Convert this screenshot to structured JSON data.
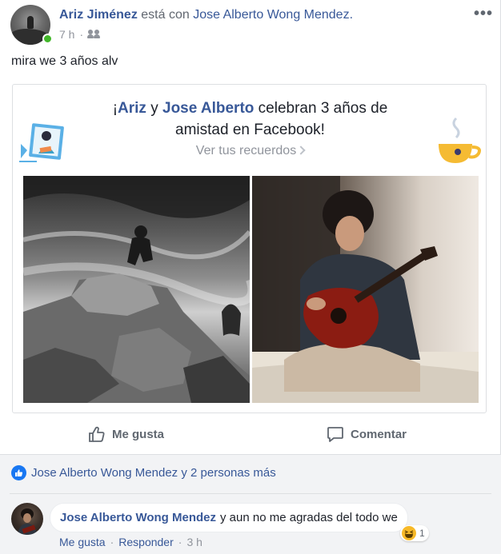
{
  "header": {
    "author": "Ariz Jiménez",
    "connector": "está con",
    "tagged": "Jose Alberto Wong Mendez.",
    "time": "7 h",
    "privacy_icon": "friends-icon",
    "more_icon": "ellipsis-icon"
  },
  "post": {
    "text": "mira we 3 años alv"
  },
  "memory": {
    "prefix": "¡",
    "name1": "Ariz",
    "and": " y ",
    "name2": "Jose Alberto",
    "line1_rest": " celebran 3 años de",
    "line2": "amistad en Facebook!",
    "link": "Ver tus recuerdos"
  },
  "actions": {
    "like": "Me gusta",
    "comment": "Comentar"
  },
  "reactions": {
    "summary": "Jose Alberto Wong Mendez y 2 personas más"
  },
  "comment": {
    "author": "Jose Alberto Wong Mendez",
    "text": "y aun no me agradas del todo we",
    "reaction_count": "1",
    "like": "Me gusta",
    "reply": "Responder",
    "time": "3 h"
  },
  "colors": {
    "link_blue": "#385898",
    "meta_gray": "#90949c",
    "like_blue": "#1877f2",
    "online_green": "#42b72a"
  }
}
